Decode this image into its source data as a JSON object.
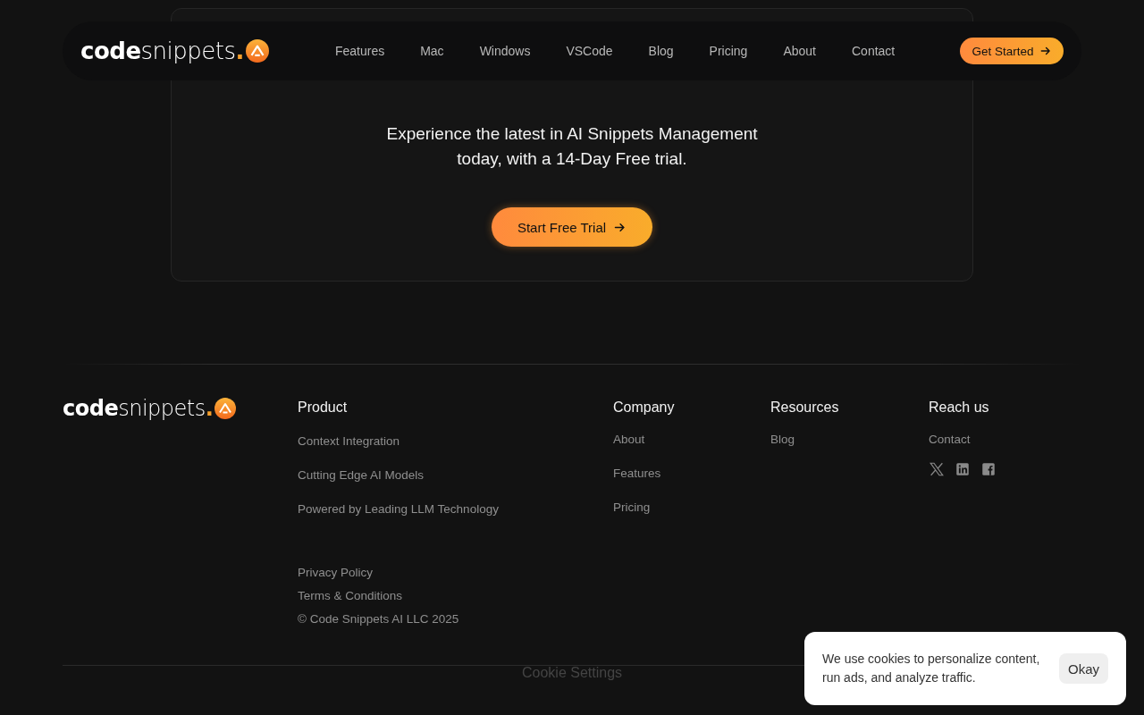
{
  "navbar": {
    "logo": {
      "bold": "code",
      "light": "snippets",
      "dot": "."
    },
    "links": [
      "Features",
      "Mac",
      "Windows",
      "VSCode",
      "Blog",
      "Pricing",
      "About",
      "Contact"
    ],
    "cta": "Get Started"
  },
  "cta_card": {
    "text": "Experience the latest in AI Snippets Management today, with a 14-Day Free trial.",
    "button": "Start Free Trial"
  },
  "footer": {
    "logo": {
      "bold": "code",
      "light": "snippets",
      "dot": "."
    },
    "columns": [
      {
        "title": "Product",
        "links": [
          "Context Integration",
          "Cutting Edge AI Models",
          "Powered by Leading LLM Technology"
        ]
      },
      {
        "title": "Company",
        "links": [
          "About",
          "Features",
          "Pricing"
        ]
      },
      {
        "title": "Resources",
        "links": [
          "Blog"
        ]
      },
      {
        "title": "Reach us",
        "links": [
          "Contact"
        ]
      }
    ],
    "legal": [
      "Privacy Policy",
      "Terms & Conditions",
      "© Code Snippets AI LLC 2025"
    ],
    "cookie_settings": "Cookie Settings"
  },
  "cookie_banner": {
    "text": "We use cookies to personalize content, run ads, and analyze traffic.",
    "button": "Okay"
  }
}
